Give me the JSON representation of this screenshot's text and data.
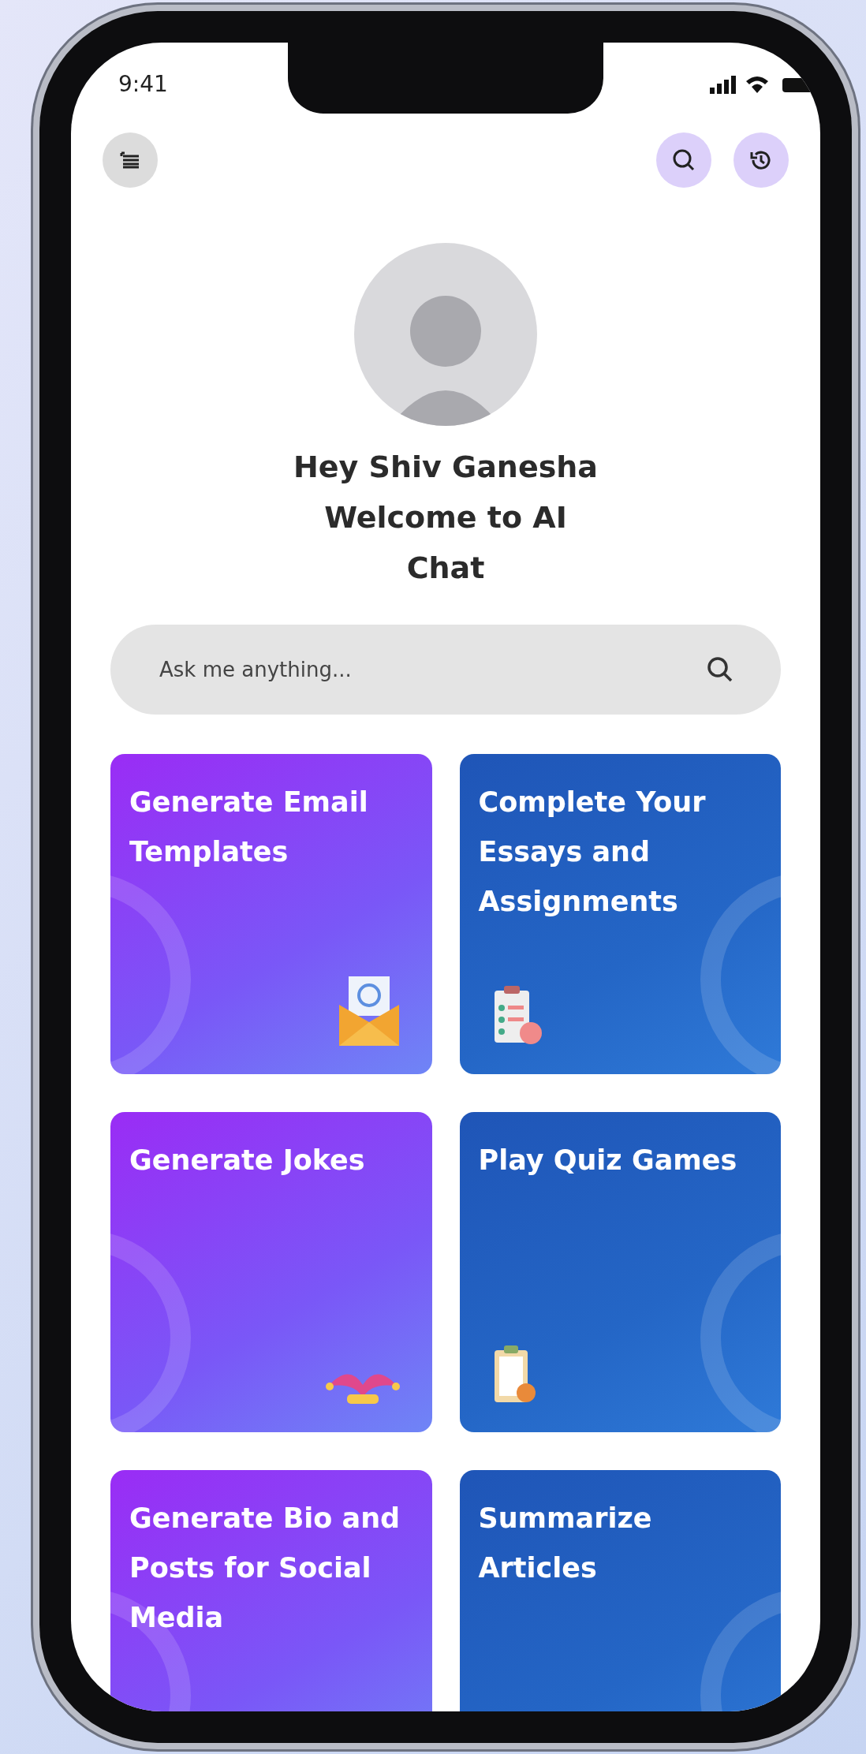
{
  "status_bar": {
    "time": "9:41"
  },
  "greeting": "Hey Shiv Ganesha",
  "subtitle": "Welcome to AI Chat",
  "search": {
    "placeholder": "Ask me anything..."
  },
  "cards": [
    {
      "kind": "email",
      "title": "Generate Email Templates"
    },
    {
      "kind": "essay",
      "title": "Complete Your Essays and Assignments"
    },
    {
      "kind": "jokes",
      "title": "Generate Jokes"
    },
    {
      "kind": "quiz",
      "title": "Play Quiz Games"
    },
    {
      "kind": "bio",
      "title": "Generate Bio and Posts for Social Media"
    },
    {
      "kind": "summary",
      "title": "Summarize Articles"
    }
  ]
}
